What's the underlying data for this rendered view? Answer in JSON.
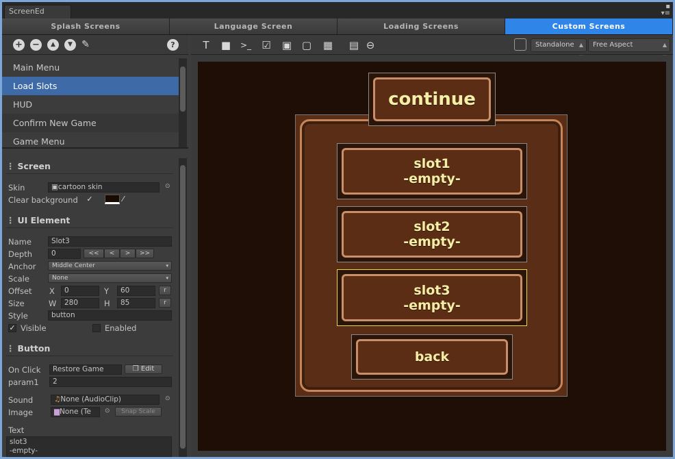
{
  "window": {
    "tab_title": "ScreenEd"
  },
  "screen_tabs": [
    {
      "label": "Splash Screens"
    },
    {
      "label": "Language Screen"
    },
    {
      "label": "Loading Screens"
    },
    {
      "label": "Custom Screens"
    }
  ],
  "toolbar": {
    "platform": "Standalone",
    "aspect": "Free Aspect"
  },
  "screens": [
    {
      "label": "Main Menu"
    },
    {
      "label": "Load Slots"
    },
    {
      "label": "HUD"
    },
    {
      "label": "Confirm New Game"
    },
    {
      "label": "Game Menu"
    }
  ],
  "inspector": {
    "screen": {
      "title": "Screen",
      "skin_label": "Skin",
      "skin_value": "cartoon skin",
      "clear_bg_label": "Clear background",
      "clear_bg_checked": "✓",
      "clear_bg_color": "#1a0a02"
    },
    "ui_element": {
      "title": "UI Element",
      "name_label": "Name",
      "name_value": "Slot3",
      "depth_label": "Depth",
      "depth_value": "0",
      "depth_buttons": [
        "<<",
        "<",
        ">",
        ">>"
      ],
      "anchor_label": "Anchor",
      "anchor_value": "Middle Center",
      "scale_label": "Scale",
      "scale_value": "None",
      "offset_label": "Offset",
      "offset_x_label": "X",
      "offset_x": "0",
      "offset_y_label": "Y",
      "offset_y": "60",
      "size_label": "Size",
      "size_w_label": "W",
      "size_w": "280",
      "size_h_label": "H",
      "size_h": "85",
      "reset_label": "r",
      "style_label": "Style",
      "style_value": "button",
      "visible_label": "Visible",
      "visible_checked": "✓",
      "enabled_label": "Enabled",
      "enabled_checked": ""
    },
    "button": {
      "title": "Button",
      "onclick_label": "On Click",
      "onclick_value": "Restore Game",
      "edit_label": "Edit",
      "param1_label": "param1",
      "param1_value": "2",
      "sound_label": "Sound",
      "sound_value": "None (AudioClip)",
      "image_label": "Image",
      "image_value": "None (Te",
      "snap_label": "Snap Scale",
      "text_label": "Text",
      "text_line1": "slot3",
      "text_line2": "-empty-"
    }
  },
  "preview": {
    "title_button": "continue",
    "slots": [
      {
        "label": "slot1\n-empty-"
      },
      {
        "label": "slot2\n-empty-"
      },
      {
        "label": "slot3\n-empty-"
      }
    ],
    "back_button": "back",
    "selected_slot": 3,
    "selection_color": "#e5d94a"
  }
}
